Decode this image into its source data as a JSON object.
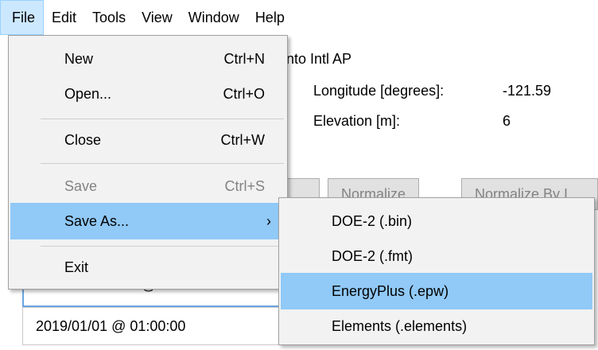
{
  "menubar": {
    "items": [
      "File",
      "Edit",
      "Tools",
      "View",
      "Window",
      "Help"
    ]
  },
  "background": {
    "location_fragment": "ento Intl AP",
    "longitude_label": "Longitude [degrees]:",
    "longitude_value": "-121.59",
    "elevation_label": "Elevation [m]:",
    "elevation_value": "6",
    "normalize_button": "Normalize",
    "normalize_by_button": "Normalize By I",
    "list_row_partial": "@",
    "list_row": "2019/01/01 @ 01:00:00"
  },
  "file_menu": {
    "new": {
      "label": "New",
      "shortcut": "Ctrl+N"
    },
    "open": {
      "label": "Open...",
      "shortcut": "Ctrl+O"
    },
    "close": {
      "label": "Close",
      "shortcut": "Ctrl+W"
    },
    "save": {
      "label": "Save",
      "shortcut": "Ctrl+S"
    },
    "save_as": {
      "label": "Save As...",
      "arrow": "›"
    },
    "exit": {
      "label": "Exit"
    }
  },
  "save_as_submenu": {
    "items": [
      "DOE-2 (.bin)",
      "DOE-2 (.fmt)",
      "EnergyPlus (.epw)",
      "Elements (.elements)"
    ]
  },
  "colors": {
    "menu_bg": "#f2f2f2",
    "highlight": "#91c9f7",
    "menubar_active": "#cce8ff",
    "disabled_text": "#838383"
  }
}
